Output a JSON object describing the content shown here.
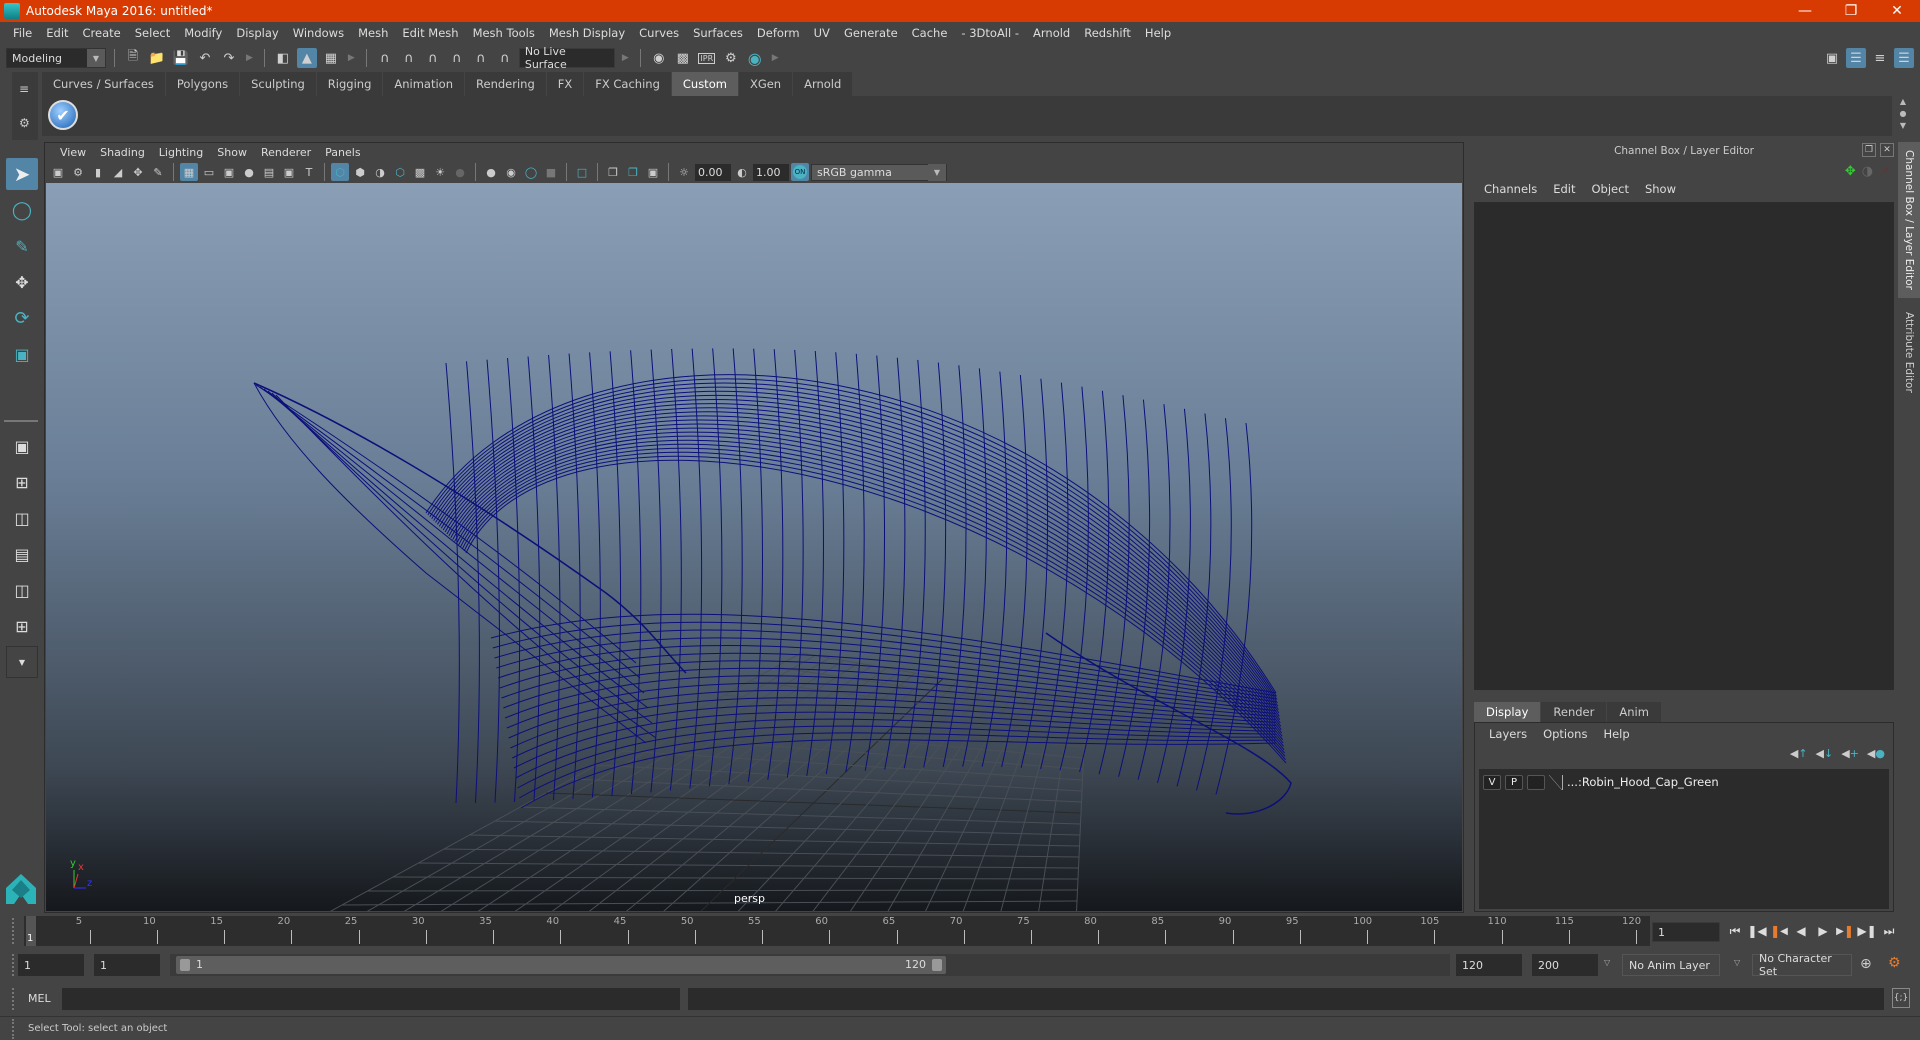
{
  "window": {
    "title": "Autodesk Maya 2016: untitled*",
    "controls": [
      "minimize",
      "restore",
      "close"
    ]
  },
  "menubar": [
    "File",
    "Edit",
    "Create",
    "Select",
    "Modify",
    "Display",
    "Windows",
    "Mesh",
    "Edit Mesh",
    "Mesh Tools",
    "Mesh Display",
    "Curves",
    "Surfaces",
    "Deform",
    "UV",
    "Generate",
    "Cache",
    "- 3DtoAll -",
    "Arnold",
    "Redshift",
    "Help"
  ],
  "toolbar": {
    "mode": "Modeling",
    "live_surface": "No Live Surface",
    "render_ipr": "IPR"
  },
  "shelf": {
    "tabs": [
      "Curves / Surfaces",
      "Polygons",
      "Sculpting",
      "Rigging",
      "Animation",
      "Rendering",
      "FX",
      "FX Caching",
      "Custom",
      "XGen",
      "Arnold"
    ],
    "active_tab": "Custom"
  },
  "viewport": {
    "menu": [
      "View",
      "Shading",
      "Lighting",
      "Show",
      "Renderer",
      "Panels"
    ],
    "exposure": "0.00",
    "gamma": "1.00",
    "color_management": "ON",
    "color_space": "sRGB gamma",
    "camera_label": "persp",
    "axis": {
      "y": "y",
      "x": "x",
      "z": "z"
    },
    "wire_color": "#0c0f7a"
  },
  "channel_box": {
    "title": "Channel Box / Layer Editor",
    "menu": [
      "Channels",
      "Edit",
      "Object",
      "Show"
    ]
  },
  "layer_editor": {
    "tabs": [
      "Display",
      "Render",
      "Anim"
    ],
    "active_tab": "Display",
    "menu": [
      "Layers",
      "Options",
      "Help"
    ],
    "layers": [
      {
        "visible": "V",
        "playback": "P",
        "name": "...:Robin_Hood_Cap_Green"
      }
    ]
  },
  "side_tabs": [
    "Channel Box / Layer Editor",
    "Attribute Editor"
  ],
  "timeline": {
    "ticks": [
      5,
      10,
      15,
      20,
      25,
      30,
      35,
      40,
      45,
      50,
      55,
      60,
      65,
      70,
      75,
      80,
      85,
      90,
      95,
      100,
      105,
      110,
      115,
      120
    ],
    "start_label": "1",
    "current_frame": "1"
  },
  "range": {
    "start_time": "1",
    "playback_start": "1",
    "slider_start": "1",
    "slider_end": "120",
    "playback_end": "120",
    "end_time": "200",
    "anim_layer": "No Anim Layer",
    "character_set": "No Character Set"
  },
  "command_line": {
    "label": "MEL",
    "value": ""
  },
  "help_line": "Select Tool: select an object",
  "colors": {
    "title_bar": "#d83b01",
    "accent": "#5285a6",
    "teal": "#4ab3c2"
  }
}
